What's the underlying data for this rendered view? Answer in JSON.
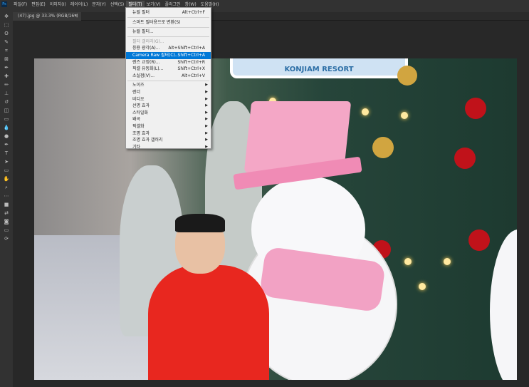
{
  "menubar": {
    "items": [
      "파일(F)",
      "편집(E)",
      "이미지(I)",
      "레이어(L)",
      "문자(Y)",
      "선택(S)",
      "필터(T)",
      "보기(V)",
      "플러그인",
      "창(W)",
      "도움말(H)"
    ],
    "active_index": 6
  },
  "document_tab": {
    "title": "(47).jpg @ 33.3% (RGB/16*)",
    "close": "×"
  },
  "photo": {
    "sign_text": "KONJIAM RESORT"
  },
  "filter_menu": {
    "group1": [
      {
        "label": "뉴럴 필터",
        "shortcut": "Alt+Ctrl+F"
      }
    ],
    "group2": [
      {
        "label": "스마트 필터용으로 변환(S)",
        "shortcut": ""
      }
    ],
    "group3": [
      {
        "label": "뉴럴 필터...",
        "shortcut": ""
      }
    ],
    "group4": [
      {
        "label": "필터 갤러리(G)...",
        "shortcut": "",
        "disabled": true
      },
      {
        "label": "응용 광각(A)...",
        "shortcut": "Alt+Shift+Ctrl+A"
      },
      {
        "label": "Camera Raw 필터(C)...",
        "shortcut": "Shift+Ctrl+A",
        "highlighted": true
      },
      {
        "label": "렌즈 교정(R)...",
        "shortcut": "Shift+Ctrl+R"
      },
      {
        "label": "픽셀 유동화(L)...",
        "shortcut": "Shift+Ctrl+X"
      },
      {
        "label": "소실점(V)...",
        "shortcut": "Alt+Ctrl+V"
      }
    ],
    "submenus": [
      "노이즈",
      "렌더",
      "비디오",
      "선명 효과",
      "스타일화",
      "왜곡",
      "픽셀화",
      "조명 효과",
      "조명 효과 갤러리",
      "기타"
    ]
  },
  "colors": {
    "highlight": "#0078d7",
    "menu_bg": "#f0f0f0",
    "ui_bg": "#323232"
  }
}
